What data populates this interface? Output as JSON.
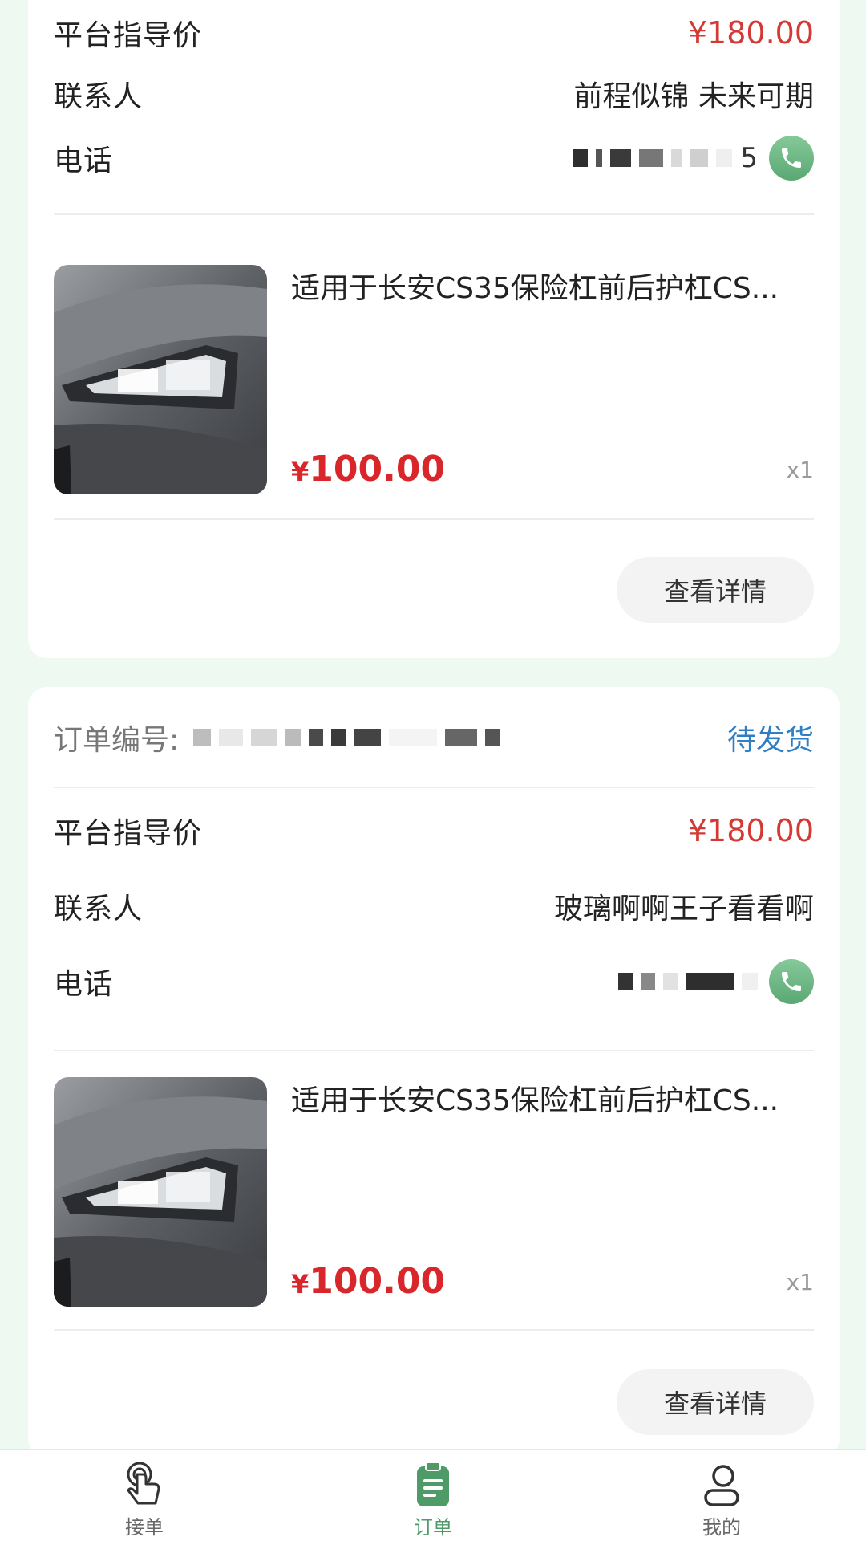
{
  "theme": {
    "accent": "#4e9b68",
    "price_red": "#d8262a",
    "status_blue": "#2f7fc5",
    "background": "#eefaf1"
  },
  "orders": [
    {
      "guide_price_label": "平台指导价",
      "guide_price": "¥180.00",
      "contact_label": "联系人",
      "contact_name": "前程似锦 未来可期",
      "phone_label": "电话",
      "phone_visible_digit": "5",
      "product": {
        "title": "适用于长安CS35保险杠前后护杠CS...",
        "price_symbol": "¥",
        "price": "100.00",
        "qty": "x1",
        "image": "car-headlight-photo"
      },
      "detail_button": "查看详情"
    },
    {
      "order_no_label": "订单编号:",
      "status": "待发货",
      "guide_price_label": "平台指导价",
      "guide_price": "¥180.00",
      "contact_label": "联系人",
      "contact_name": "玻璃啊啊王子看看啊",
      "phone_label": "电话",
      "product": {
        "title": "适用于长安CS35保险杠前后护杠CS...",
        "price_symbol": "¥",
        "price": "100.00",
        "qty": "x1",
        "image": "car-headlight-photo"
      },
      "detail_button": "查看详情"
    }
  ],
  "tabbar": {
    "items": [
      {
        "label": "接单",
        "icon": "hand-tap-icon",
        "active": false
      },
      {
        "label": "订单",
        "icon": "clipboard-icon",
        "active": true
      },
      {
        "label": "我的",
        "icon": "user-icon",
        "active": false
      }
    ]
  }
}
